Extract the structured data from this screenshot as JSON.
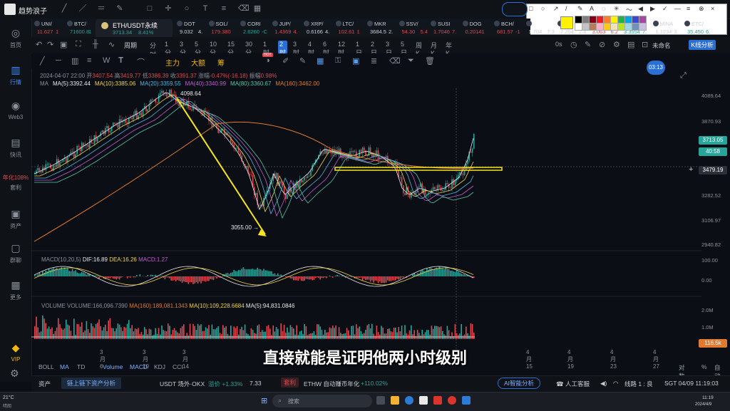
{
  "app": {
    "name": "趋势浪子"
  },
  "tickers": [
    {
      "name": "UNI/",
      "price": "11.627",
      "chg": "1",
      "color": "#e0474f"
    },
    {
      "name": "BTC/",
      "price": "71600.8",
      "chg": "1",
      "color": "#26a69a"
    },
    {
      "name": "DOT",
      "price": "9.032",
      "chg": "4.",
      "color": "#c9ced6"
    },
    {
      "name": "SOL/",
      "price": "179.380",
      "chg": "",
      "color": "#e0474f"
    },
    {
      "name": "CORI",
      "price": "2.6260",
      "chg": "-C",
      "color": "#26a69a"
    },
    {
      "name": "JUP/",
      "price": "1.4369",
      "chg": "4.",
      "color": "#e0474f"
    },
    {
      "name": "XRP/",
      "price": "0.6166",
      "chg": "4.",
      "color": "#c9ced6"
    },
    {
      "name": "LTC/",
      "price": "102.61",
      "chg": "1",
      "color": "#e0474f"
    },
    {
      "name": "MKR",
      "price": "3684.5",
      "chg": "2.",
      "color": "#c9ced6"
    },
    {
      "name": "SSV/",
      "price": "54.30",
      "chg": "5.4",
      "color": "#e0474f"
    },
    {
      "name": "SUSI",
      "price": "1.7046",
      "chg": "7.",
      "color": "#e0474f"
    },
    {
      "name": "DOG",
      "price": "0.20141",
      "chg": "",
      "color": "#e0474f"
    },
    {
      "name": "BCH/",
      "price": "681.57",
      "chg": "-1",
      "color": "#e0474f"
    },
    {
      "name": "",
      "price": "1.704",
      "chg": "7.3",
      "color": "#c9ced6"
    },
    {
      "name": "",
      "price": "7.264",
      "chg": "2.4",
      "color": "#c9ced6"
    },
    {
      "name": "",
      "price": "3.063",
      "chg": "6.2",
      "color": "#e0474f"
    },
    {
      "name": "OP/L",
      "price": "3.3554",
      "chg": "7.",
      "color": "#26a69a"
    },
    {
      "name": "MINA",
      "price": "1.1234",
      "chg": "3.",
      "color": "#c9ced6"
    },
    {
      "name": "ETC/",
      "price": "35.450",
      "chg": "6.",
      "color": "#26a69a"
    }
  ],
  "active_tab": {
    "symbol": "ETH/USDT永续",
    "price": "3713.34",
    "chg": "8.41%"
  },
  "sidebar": [
    {
      "label": "首页",
      "icon": "home-icon",
      "glyph": "◎"
    },
    {
      "label": "行情",
      "icon": "market-icon",
      "glyph": "▥",
      "active": true
    },
    {
      "label": "Web3",
      "icon": "web3-icon",
      "glyph": "◉"
    },
    {
      "label": "快讯",
      "icon": "news-icon",
      "glyph": "▤"
    },
    {
      "label": "年化108%",
      "sub": "套利",
      "icon": "arbitrage-icon",
      "glyph": "",
      "special": true
    },
    {
      "label": "资产",
      "icon": "wallet-icon",
      "glyph": "▣"
    },
    {
      "label": "群聊",
      "icon": "chat-icon",
      "glyph": "▢"
    },
    {
      "label": "更多",
      "icon": "more-icon",
      "glyph": "▦"
    },
    {
      "label": "VIP",
      "icon": "vip-icon",
      "glyph": "◆"
    }
  ],
  "toolbar": {
    "period_label": "周期",
    "timeframes": [
      "分时",
      "1分",
      "3分",
      "5分",
      "10分",
      "15分",
      "30分",
      "1时",
      "2时",
      "3时",
      "4时",
      "6时",
      "12时",
      "1日",
      "2日",
      "3日",
      "5日",
      "周K",
      "月K",
      "年K"
    ],
    "active_timeframe": "2时",
    "right_zero": "0s",
    "layout_name": "未命名",
    "k_analysis": "K线分析"
  },
  "indicator_buttons": [
    "主力",
    "大额",
    "筹"
  ],
  "ohlc": {
    "date": "2024-04-07 22:00",
    "open_label": "开",
    "open": "3407.54",
    "high_label": "高",
    "high": "3419.77",
    "low_label": "低",
    "low": "3386.39",
    "close_label": "收",
    "close": "3391.37",
    "chg_label": "涨幅",
    "chg": "-0.47%(-16.18)",
    "amp_label": "振幅",
    "amp": "0.98%"
  },
  "ma": {
    "label": "MA",
    "items": [
      {
        "text": "MA(5):3392.44",
        "color": "#e8e8e8"
      },
      {
        "text": "MA(10):3385.06",
        "color": "#f0d24b"
      },
      {
        "text": "MA(20):3359.55",
        "color": "#4fb6e0"
      },
      {
        "text": "MA(40):3340.99",
        "color": "#c65bd6"
      },
      {
        "text": "MA(80):3360.67",
        "color": "#57c7a4"
      },
      {
        "text": "MA(160):3462.00",
        "color": "#e07a2f"
      }
    ]
  },
  "macd": {
    "label": "MACD(10,20,5)",
    "dif": "DIF:16.89",
    "dea": "DEA:16.26",
    "macd": "MACD:1.27"
  },
  "volume": {
    "label": "VOLUME",
    "vol": "VOLUME:166,096.7390",
    "ma160": "MA(160):189,081.1343",
    "ma10": "MA(10):109,228.6684",
    "ma5": "MA(5):94,831.0846"
  },
  "price_axis": [
    "4089.64",
    "3870.93",
    "3713.05",
    "40:58",
    "3479.19",
    "3282.52",
    "3106.97",
    "2940.82"
  ],
  "macd_axis": [
    "100.00",
    "0.00"
  ],
  "vol_axis": [
    "2.0M",
    "1.0M",
    "116.5k"
  ],
  "annotations": {
    "high": "4098.64",
    "low": "3055.00",
    "timer": "03:13"
  },
  "x_axis": [
    "3月6",
    "3月10",
    "3月14",
    "4月15",
    "4月19",
    "4月23",
    "4月27"
  ],
  "bottom_tabs": [
    "BOLL",
    "MA",
    "TD",
    "Volume",
    "MACD",
    "KDJ",
    "CCI"
  ],
  "bottom_right": [
    "对数",
    "%",
    "自动"
  ],
  "status": {
    "assets": "资产",
    "assets_btn": "链上链下资产分析",
    "usdt": "USDT 场外·OKX",
    "usdt_prem": "溢价 +1.33%",
    "usdt_val": "7.33",
    "arb": "套利",
    "ethw": "ETHW 自动赚币年化",
    "ethw_pct": "+110.02%",
    "ai": "AI智能分析",
    "service": "人工客服",
    "line": "线路 1 : 良",
    "clock": "SGT  04/09 11:19:03"
  },
  "taskbar": {
    "weather": "21°C",
    "weather_sub": "晴朗",
    "search": "搜索",
    "time": "11:19",
    "date": "2024/4/9"
  },
  "subtitle": "直接就能是证明他两小时级别",
  "colors": {
    "up": "#26a69a",
    "down": "#e0474f",
    "yellow": "#f5e51b",
    "accent": "#2a6fd6"
  }
}
